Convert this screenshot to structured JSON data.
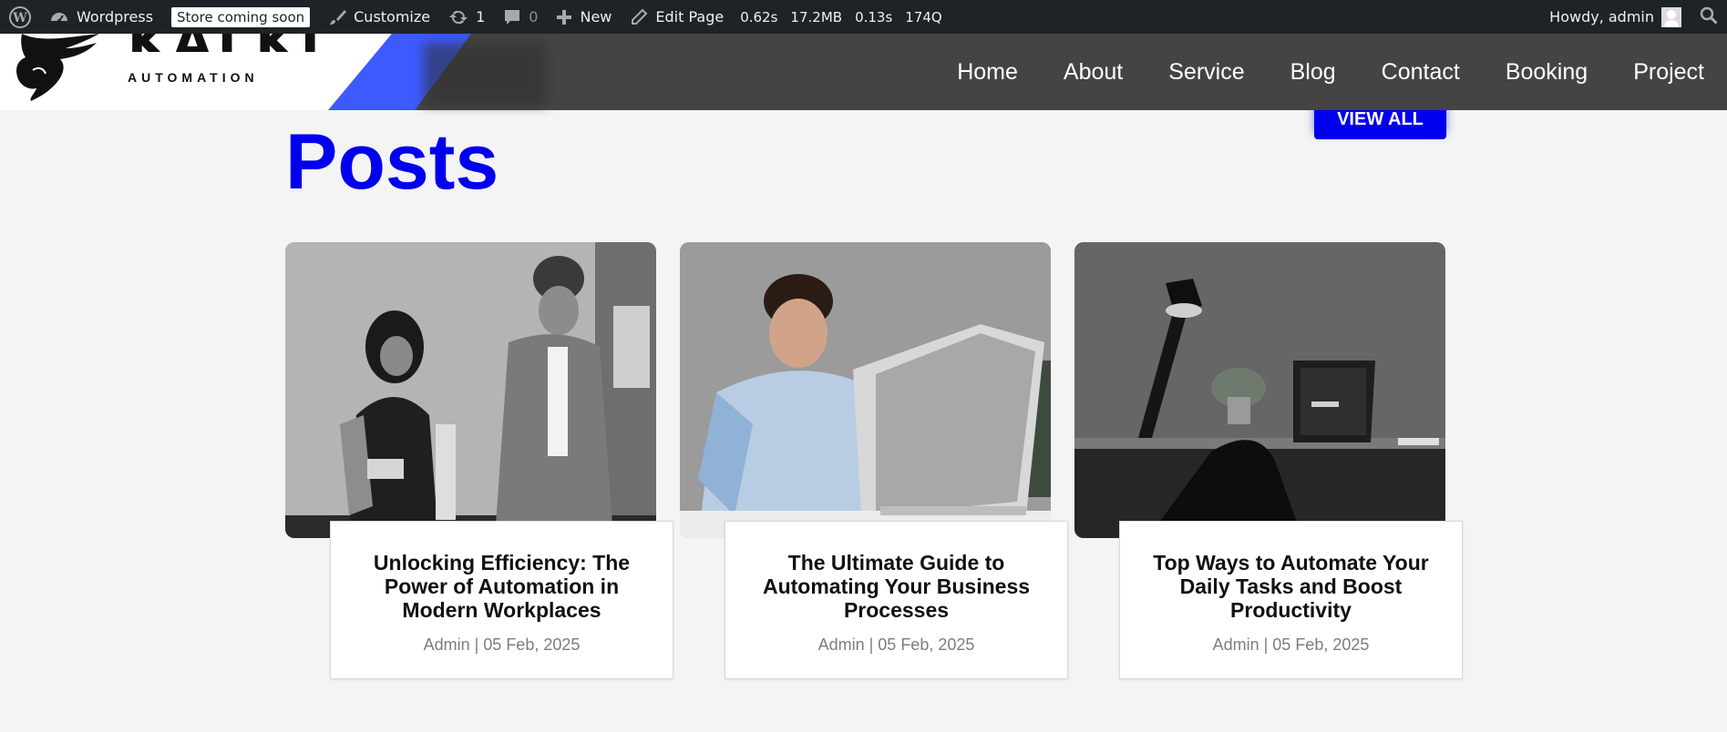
{
  "adminbar": {
    "site_name": "Wordpress",
    "store_badge": "Store coming soon",
    "customize": "Customize",
    "updates_count": "1",
    "comments_count": "0",
    "new_label": "New",
    "edit_page": "Edit Page",
    "stats": [
      "0.62s",
      "17.2MB",
      "0.13s",
      "174Q"
    ],
    "howdy": "Howdy, admin"
  },
  "header": {
    "brand": "KALKI",
    "brand_sub": "AUTOMATION",
    "nav": [
      "Home",
      "About",
      "Service",
      "Blog",
      "Contact",
      "Booking",
      "Project"
    ]
  },
  "posts": {
    "title": "Posts",
    "view_all": "VIEW ALL",
    "items": [
      {
        "title": "Unlocking Efficiency: The Power of Automation in Modern Workplaces",
        "meta": "Admin | 05 Feb, 2025",
        "image": "two-people-office-photo"
      },
      {
        "title": "The Ultimate Guide to Automating Your Business Processes",
        "meta": "Admin | 05 Feb, 2025",
        "image": "man-at-computer-photo"
      },
      {
        "title": "Top Ways to Automate Your Daily Tasks and Boost Productivity",
        "meta": "Admin | 05 Feb, 2025",
        "image": "desk-lamp-laptop-photo"
      }
    ]
  },
  "colors": {
    "accent": "#0000ee",
    "header_bg": "#444444",
    "adminbar_bg": "#1d2327",
    "logo_blue": "#3d5afe"
  }
}
